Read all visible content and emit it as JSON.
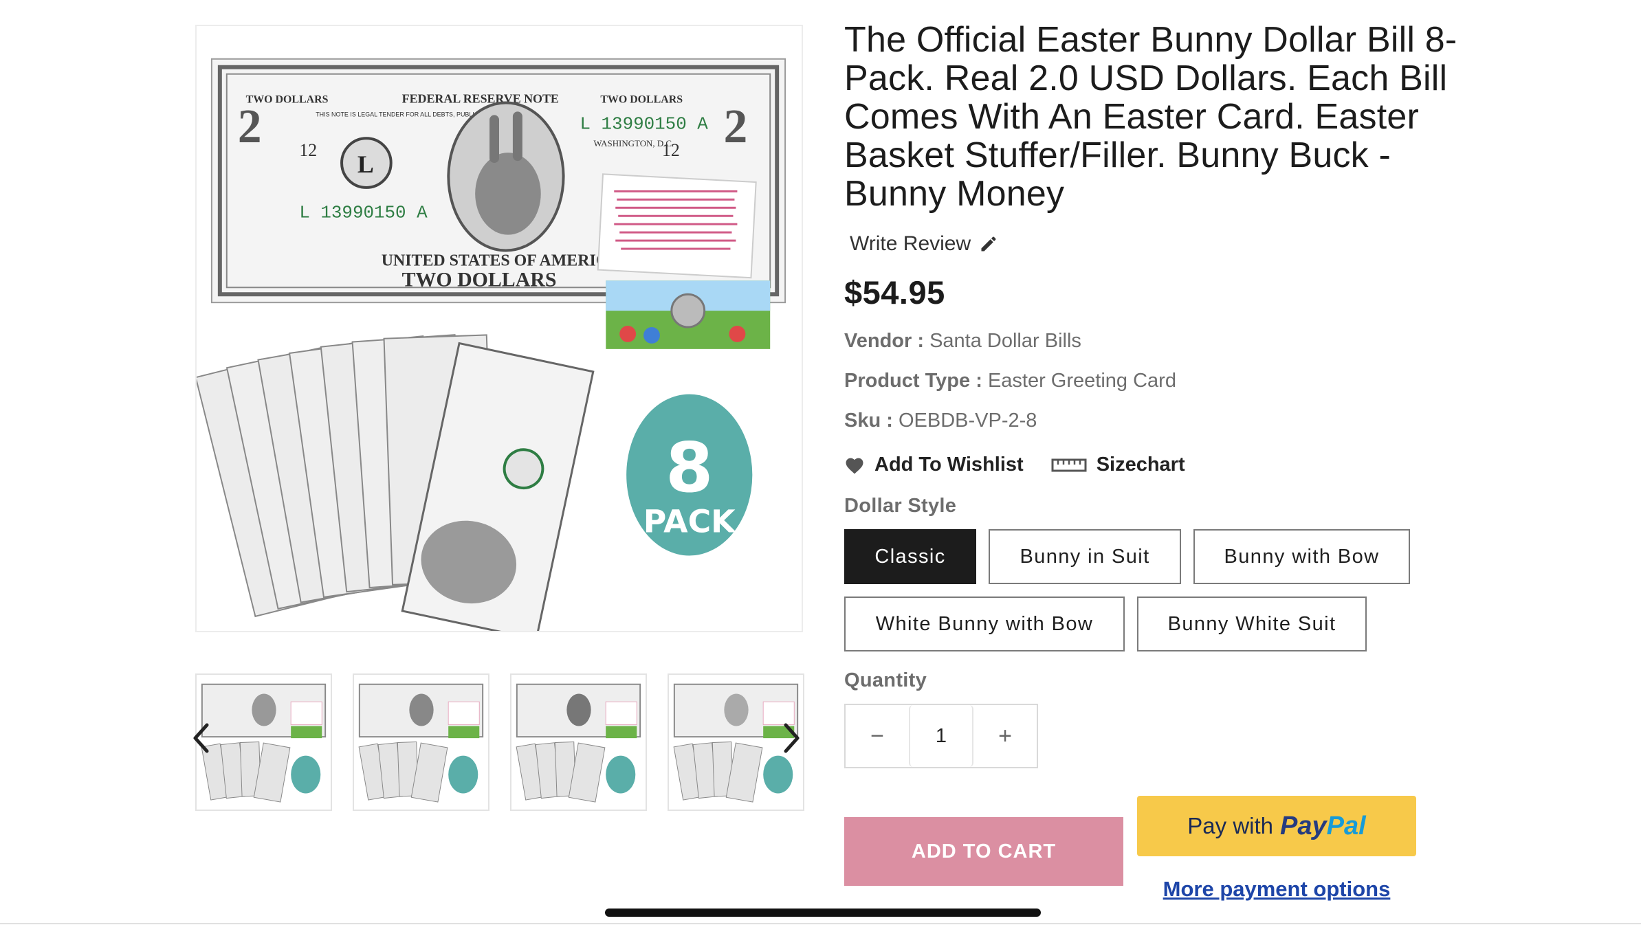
{
  "product": {
    "title": "The Official Easter Bunny Dollar Bill 8-Pack. Real 2.0 USD Dollars. Each Bill Comes With An Easter Card. Easter Basket Stuffer/Filler. Bunny Buck - Bunny Money",
    "write_review": "Write Review",
    "price": "$54.95",
    "vendor": {
      "label": "Vendor :",
      "value": "Santa Dollar Bills"
    },
    "product_type": {
      "label": "Product Type :",
      "value": "Easter Greeting Card"
    },
    "sku": {
      "label": "Sku :",
      "value": "OEBDB-VP-2-8"
    },
    "wishlist_label": "Add To Wishlist",
    "sizechart_label": "Sizechart"
  },
  "image_text": {
    "bill_top_left": "TWO DOLLARS",
    "bill_top_right": "TWO DOLLARS",
    "bill_banner": "FEDERAL RESERVE NOTE",
    "legal_tender": "THIS NOTE IS LEGAL TENDER FOR ALL DEBTS, PUBLIC AND PRIVATE",
    "serial": "L 13990150 A",
    "district_letter": "L",
    "location": "WASHINGTON, D.C.",
    "district_number": "12",
    "corner_number": "2",
    "bottom_banner": "UNITED STATES OF AMERICA",
    "bottom_text": "TWO DOLLARS",
    "pack_number": "8",
    "pack_word": "PACK"
  },
  "dollar_style": {
    "label": "Dollar Style",
    "options": [
      {
        "label": "Classic",
        "selected": true
      },
      {
        "label": "Bunny in Suit",
        "selected": false
      },
      {
        "label": "Bunny with Bow",
        "selected": false
      },
      {
        "label": "White Bunny with Bow",
        "selected": false
      },
      {
        "label": "Bunny White Suit",
        "selected": false
      }
    ]
  },
  "quantity": {
    "label": "Quantity",
    "value": "1",
    "minus": "−",
    "plus": "+"
  },
  "buttons": {
    "add_to_cart": "ADD TO CART",
    "paypal_prefix": "Pay with",
    "paypal_brand_1": "Pay",
    "paypal_brand_2": "Pal",
    "more_payment": "More payment options"
  },
  "colors": {
    "accent_cart": "#db8fa2",
    "paypal_yellow": "#f7c94a",
    "pack_teal": "#5aaea9",
    "selected_option": "#1c1c1c",
    "link_blue": "#1d45a8"
  },
  "thumbnails": {
    "count": 4,
    "selected_index": 0
  }
}
